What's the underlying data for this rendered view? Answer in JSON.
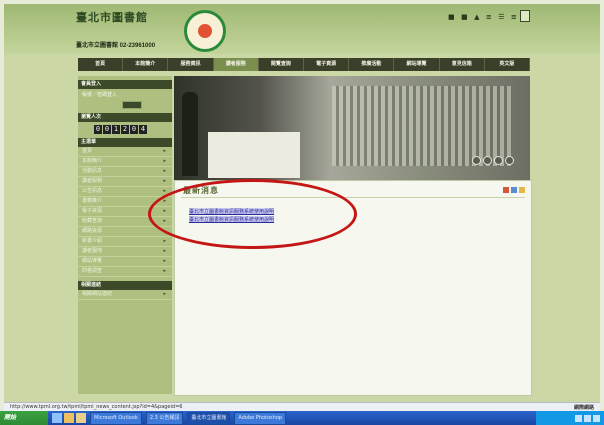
{
  "header": {
    "logo_text": "臺北市圖書館",
    "address_line": "臺北市立圖書館 02-23961000",
    "top_links": "■ ■ ▲ ≡ ☰ ≡"
  },
  "nav": {
    "items": [
      "首頁",
      "本館簡介",
      "服務資訊",
      "讀者服務",
      "閱覽查詢",
      "電子資源",
      "推廣活動",
      "網站導覽",
      "意見信箱",
      "英文版"
    ],
    "active_index": 3
  },
  "sidebar": {
    "login_title": "會員登入",
    "login_text": "帳號／密碼登入",
    "counter_title": "瀏覽人次",
    "counter_digits": [
      "0",
      "0",
      "1",
      "2",
      "0",
      "4"
    ],
    "menu_title": "主選單",
    "items": [
      "首頁",
      "本館簡介",
      "活動訊息",
      "讀者服務",
      "公告訊息",
      "書籍推介",
      "電子資源",
      "館藏查詢",
      "網路資源",
      "新書介紹",
      "讀者園地",
      "網站導覽",
      "問卷調查"
    ],
    "links_title": "相關連結",
    "links_item": "相關網站連結"
  },
  "content": {
    "title": "最新消息",
    "links": [
      "臺北市立圖書館資訊服務系統使用說明",
      "臺北市立圖書館資訊服務系統使用說明"
    ]
  },
  "statusbar": {
    "url": "http://www.tpml.org.tw/tpml/tpml_news_content.jsp?id=4&pageid=6",
    "zone": "網際網路"
  },
  "taskbar": {
    "start": "開始",
    "tasks": [
      "Microsoft Outlook",
      "2.3 公告報訊",
      "臺北市立圖書館",
      "Adobe Photoshop"
    ],
    "active_index": 2
  },
  "colors": {
    "nav_bg": "#3a3f2a",
    "sidebar_bg": "#aebf7f",
    "highlight_ellipse": "#c51616",
    "link_color": "#2a2a9a"
  }
}
